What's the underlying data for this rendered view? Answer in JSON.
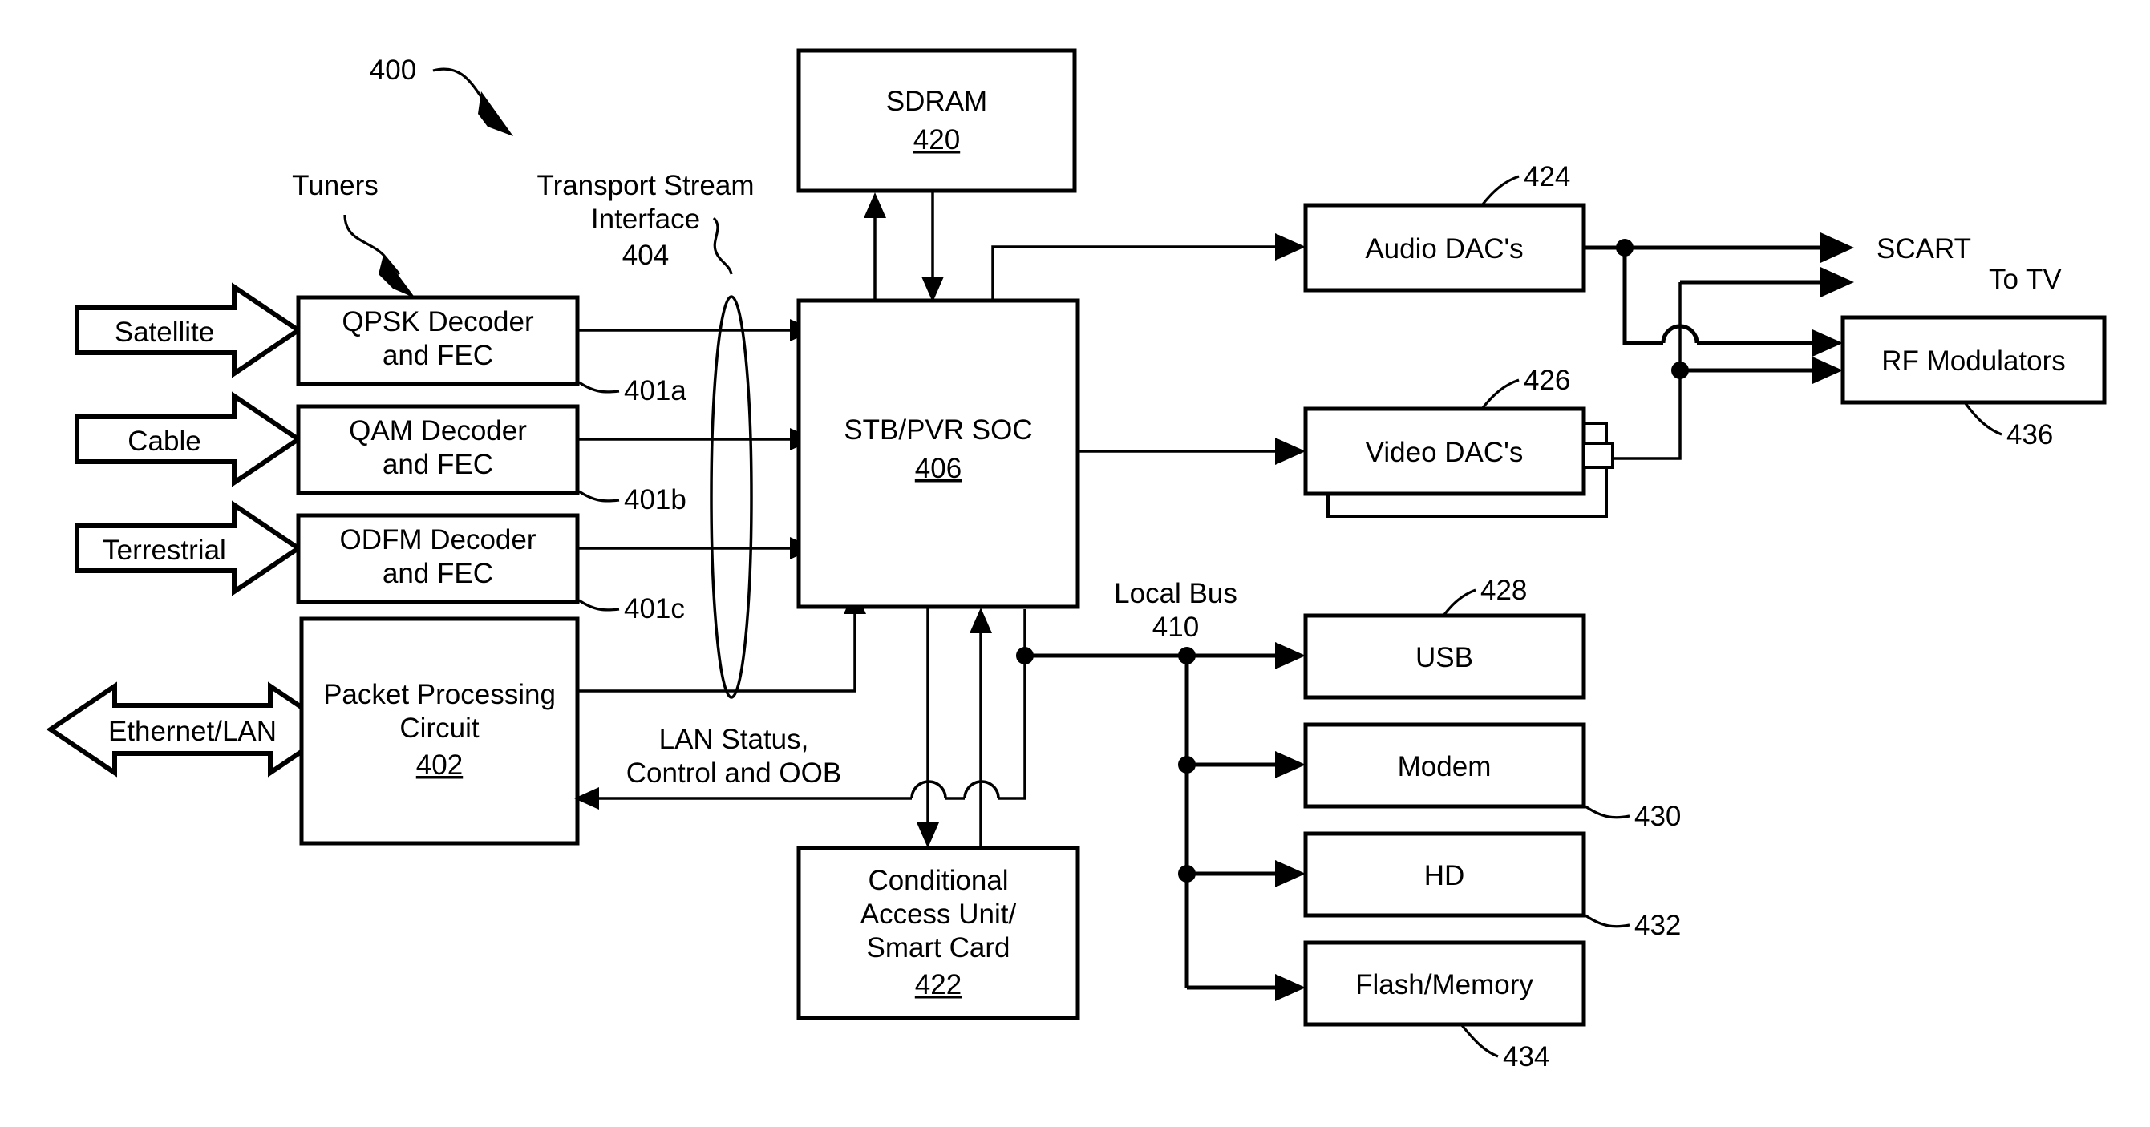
{
  "figure": {
    "number": "400",
    "title_visible": false
  },
  "group_labels": {
    "tuners": "Tuners",
    "transport_stream_interface": "Transport Stream\nInterface",
    "transport_stream_interface_line1": "Transport Stream",
    "transport_stream_interface_line2": "Interface",
    "transport_stream_interface_ref": "404",
    "local_bus_line1": "Local Bus",
    "local_bus_ref": "410",
    "lan_status_line1": "LAN Status,",
    "lan_status_line2": "Control and OOB",
    "to_tv": "To TV",
    "scart": "SCART"
  },
  "inputs": [
    {
      "name": "satellite",
      "label": "Satellite"
    },
    {
      "name": "cable",
      "label": "Cable"
    },
    {
      "name": "terrestrial",
      "label": "Terrestrial"
    },
    {
      "name": "ethernet-lan",
      "label": "Ethernet/LAN"
    }
  ],
  "blocks": {
    "qpsk": {
      "line1": "QPSK Decoder",
      "line2": "and FEC",
      "ref": "401a"
    },
    "qam": {
      "line1": "QAM Decoder",
      "line2": "and FEC",
      "ref": "401b"
    },
    "odfm": {
      "line1": "ODFM Decoder",
      "line2": "and FEC",
      "ref": "401c"
    },
    "packet_processing": {
      "line1": "Packet Processing",
      "line2": "Circuit",
      "ref": "402"
    },
    "sdram": {
      "line1": "SDRAM",
      "ref": "420"
    },
    "soc": {
      "line1": "STB/PVR SOC",
      "ref": "406"
    },
    "conditional_access": {
      "line1": "Conditional",
      "line2": "Access Unit/",
      "line3": "Smart Card",
      "ref": "422"
    },
    "audio_dacs": {
      "line1": "Audio DAC's",
      "ref": "424"
    },
    "video_dacs": {
      "line1": "Video DAC's",
      "ref": "426"
    },
    "rf_modulators": {
      "line1": "RF Modulators",
      "ref": "436"
    },
    "usb": {
      "line1": "USB",
      "ref": "428"
    },
    "modem": {
      "line1": "Modem",
      "ref": "430"
    },
    "hd": {
      "line1": "HD",
      "ref": "432"
    },
    "flash_memory": {
      "line1": "Flash/Memory",
      "ref": "434"
    }
  },
  "colors": {
    "ink": "#000000",
    "paper": "#ffffff"
  }
}
